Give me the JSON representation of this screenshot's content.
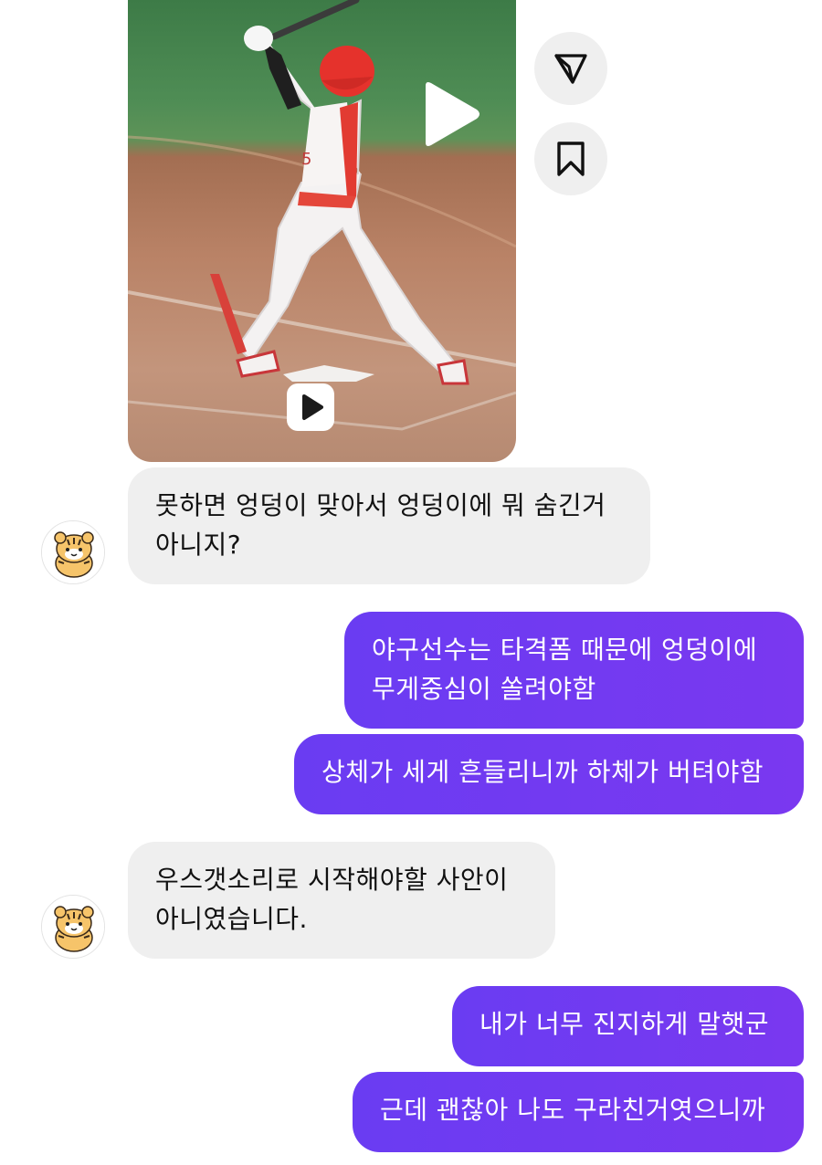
{
  "media": {
    "icons": {
      "play": "play-icon",
      "reel": "reel-icon",
      "share": "paper-plane-icon",
      "save": "bookmark-icon"
    }
  },
  "messages": [
    {
      "sender": "other",
      "text": "못하면 엉덩이 맞아서 엉덩이에 뭐 숨긴거\n아니지?"
    },
    {
      "sender": "me",
      "text": "야구선수는 타격폼 때문에 엉덩이에\n무게중심이 쏠려야함"
    },
    {
      "sender": "me",
      "text": "상체가 세게 흔들리니까 하체가 버텨야함"
    },
    {
      "sender": "other",
      "text": "우스갯소리로 시작해야할 사안이\n아니였습니다."
    },
    {
      "sender": "me",
      "text": "내가 너무 진지하게 말햇군"
    },
    {
      "sender": "me",
      "text": "근데 괜찮아 나도 구라친거엿으니까"
    }
  ],
  "colors": {
    "incoming_bubble": "#efefef",
    "outgoing_bubble": "#7039f1",
    "outgoing_text": "#ffffff",
    "icon_button_bg": "#efefef"
  }
}
